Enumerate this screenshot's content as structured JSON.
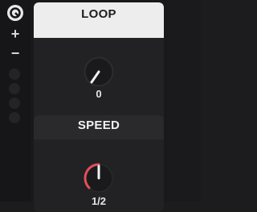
{
  "sidebar": {
    "buttons": [
      {
        "name": "logo",
        "icon": "power-ring-icon"
      },
      {
        "name": "zoom-in",
        "label": "+",
        "icon": "plus-icon"
      },
      {
        "name": "zoom-out",
        "label": "−",
        "icon": "minus-icon"
      }
    ]
  },
  "panels": {
    "loop": {
      "title": "LOOP",
      "value": "0"
    },
    "speed": {
      "title": "SPEED",
      "value": "1/2"
    }
  },
  "colors": {
    "header_active": "#ededed",
    "accent_red": "#e0505a",
    "background": "#1c1c1e"
  }
}
